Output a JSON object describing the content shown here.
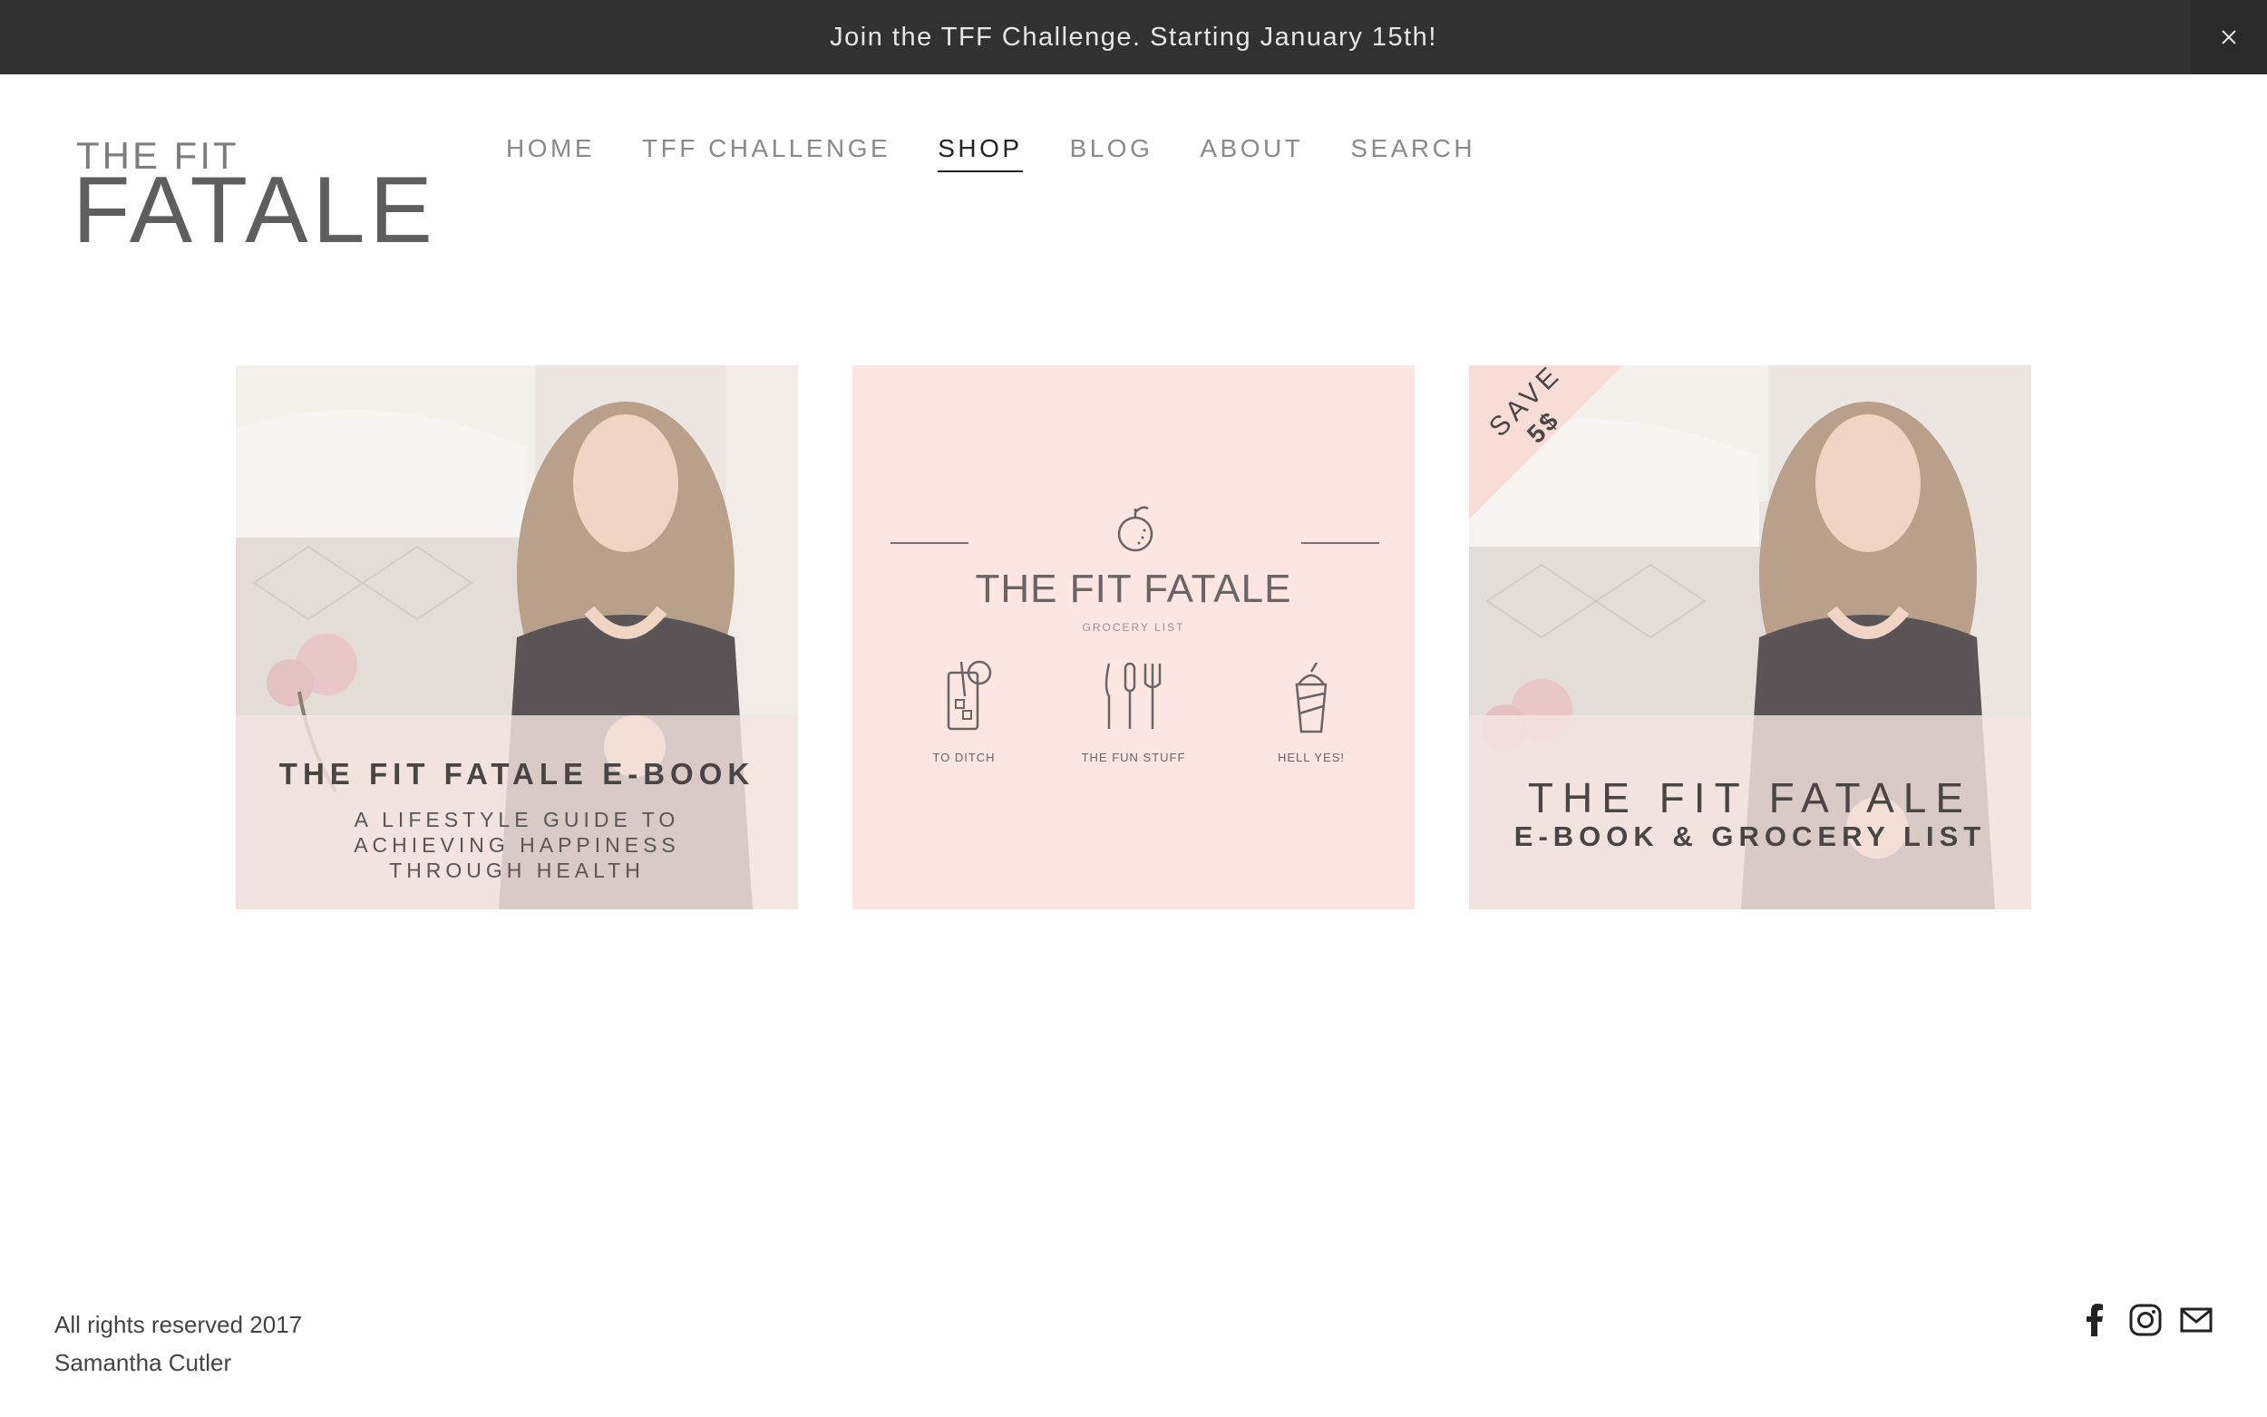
{
  "announcement": {
    "text": "Join the TFF Challenge. Starting January 15th!",
    "close": "×"
  },
  "logo": {
    "top": "THE FIT",
    "main": "FATALE"
  },
  "nav": [
    {
      "label": "HOME",
      "active": false
    },
    {
      "label": "TFF CHALLENGE",
      "active": false
    },
    {
      "label": "SHOP",
      "active": true
    },
    {
      "label": "BLOG",
      "active": false
    },
    {
      "label": "ABOUT",
      "active": false
    },
    {
      "label": "SEARCH",
      "active": false
    }
  ],
  "products": [
    {
      "title": "THE FIT FATALE E-BOOK",
      "subtitle_lines": [
        "A LIFESTYLE GUIDE TO",
        "ACHIEVING HAPPINESS",
        "THROUGH HEALTH"
      ]
    },
    {
      "title": "THE FIT FATALE",
      "subtitle": "GROCERY LIST",
      "captions": [
        "TO DITCH",
        "THE FUN STUFF",
        "HELL YES!"
      ]
    },
    {
      "badge_text": "SAVE",
      "badge_amount": "5$",
      "title": "THE FIT FATALE",
      "subtitle": "E-BOOK & GROCERY LIST"
    }
  ],
  "footer": {
    "line1": "All rights reserved 2017",
    "line2": "Samantha Cutler"
  },
  "social": [
    "facebook-icon",
    "instagram-icon",
    "email-icon"
  ],
  "colors": {
    "bar": "#313131",
    "pink": "#fbe6e2",
    "active_nav": "#222222"
  }
}
